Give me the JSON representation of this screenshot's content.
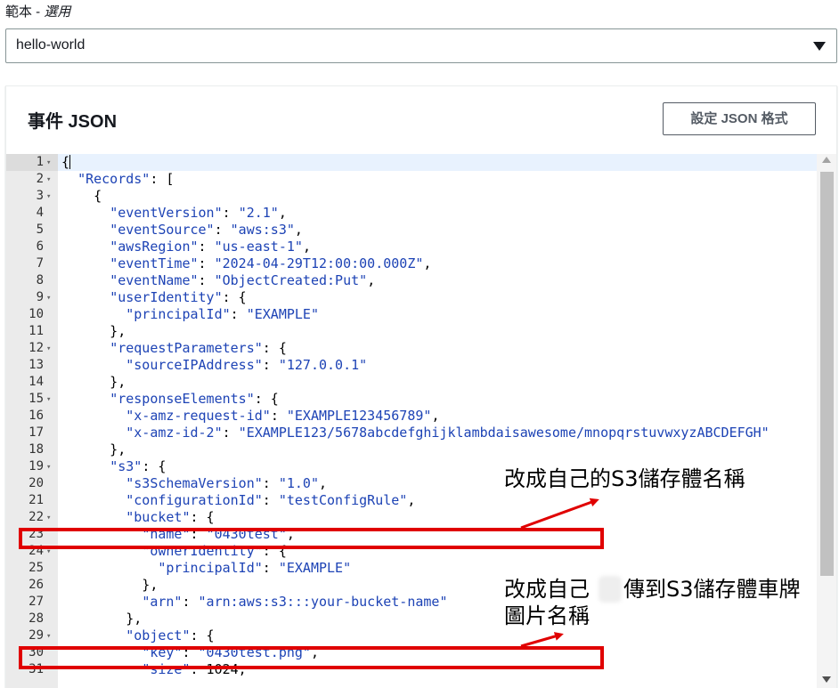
{
  "template": {
    "label": "範本",
    "sep": " - ",
    "optional": "選用",
    "selected": "hello-world"
  },
  "panel": {
    "title": "事件 JSON",
    "format_button": "設定 JSON 格式"
  },
  "code_lines": [
    {
      "n": "1",
      "fold": true,
      "text": "{"
    },
    {
      "n": "2",
      "fold": true,
      "text": "  \"Records\": ["
    },
    {
      "n": "3",
      "fold": true,
      "text": "    {"
    },
    {
      "n": "4",
      "fold": false,
      "text": "      \"eventVersion\": \"2.1\","
    },
    {
      "n": "5",
      "fold": false,
      "text": "      \"eventSource\": \"aws:s3\","
    },
    {
      "n": "6",
      "fold": false,
      "text": "      \"awsRegion\": \"us-east-1\","
    },
    {
      "n": "7",
      "fold": false,
      "text": "      \"eventTime\": \"2024-04-29T12:00:00.000Z\","
    },
    {
      "n": "8",
      "fold": false,
      "text": "      \"eventName\": \"ObjectCreated:Put\","
    },
    {
      "n": "9",
      "fold": true,
      "text": "      \"userIdentity\": {"
    },
    {
      "n": "10",
      "fold": false,
      "text": "        \"principalId\": \"EXAMPLE\""
    },
    {
      "n": "11",
      "fold": false,
      "text": "      },"
    },
    {
      "n": "12",
      "fold": true,
      "text": "      \"requestParameters\": {"
    },
    {
      "n": "13",
      "fold": false,
      "text": "        \"sourceIPAddress\": \"127.0.0.1\""
    },
    {
      "n": "14",
      "fold": false,
      "text": "      },"
    },
    {
      "n": "15",
      "fold": true,
      "text": "      \"responseElements\": {"
    },
    {
      "n": "16",
      "fold": false,
      "text": "        \"x-amz-request-id\": \"EXAMPLE123456789\","
    },
    {
      "n": "17",
      "fold": false,
      "text": "        \"x-amz-id-2\": \"EXAMPLE123/5678abcdefghijklambdaisawesome/mnopqrstuvwxyzABCDEFGH\""
    },
    {
      "n": "18",
      "fold": false,
      "text": "      },"
    },
    {
      "n": "19",
      "fold": true,
      "text": "      \"s3\": {"
    },
    {
      "n": "20",
      "fold": false,
      "text": "        \"s3SchemaVersion\": \"1.0\","
    },
    {
      "n": "21",
      "fold": false,
      "text": "        \"configurationId\": \"testConfigRule\","
    },
    {
      "n": "22",
      "fold": true,
      "text": "        \"bucket\": {"
    },
    {
      "n": "23",
      "fold": false,
      "text": "          \"name\": \"0430test\","
    },
    {
      "n": "24",
      "fold": true,
      "text": "          \"ownerIdentity\": {"
    },
    {
      "n": "25",
      "fold": false,
      "text": "            \"principalId\": \"EXAMPLE\""
    },
    {
      "n": "26",
      "fold": false,
      "text": "          },"
    },
    {
      "n": "27",
      "fold": false,
      "text": "          \"arn\": \"arn:aws:s3:::your-bucket-name\""
    },
    {
      "n": "28",
      "fold": false,
      "text": "        },"
    },
    {
      "n": "29",
      "fold": true,
      "text": "        \"object\": {"
    },
    {
      "n": "30",
      "fold": false,
      "text": "          \"key\": \"0430test.png\","
    },
    {
      "n": "31",
      "fold": false,
      "text": "          \"size\": 1024,"
    }
  ],
  "annotations": {
    "note1": "改成自己的S3儲存體名稱",
    "note2_line1": "改成自己",
    "note2_line1b": "傳到S3儲存體車牌",
    "note2_line2": "圖片名稱",
    "color": "#e00000"
  },
  "icons": {
    "dropdown": "caret-down-icon",
    "fold": "fold-arrow-icon",
    "scroll_up": "scroll-up-icon",
    "scroll_down": "scroll-down-icon"
  }
}
